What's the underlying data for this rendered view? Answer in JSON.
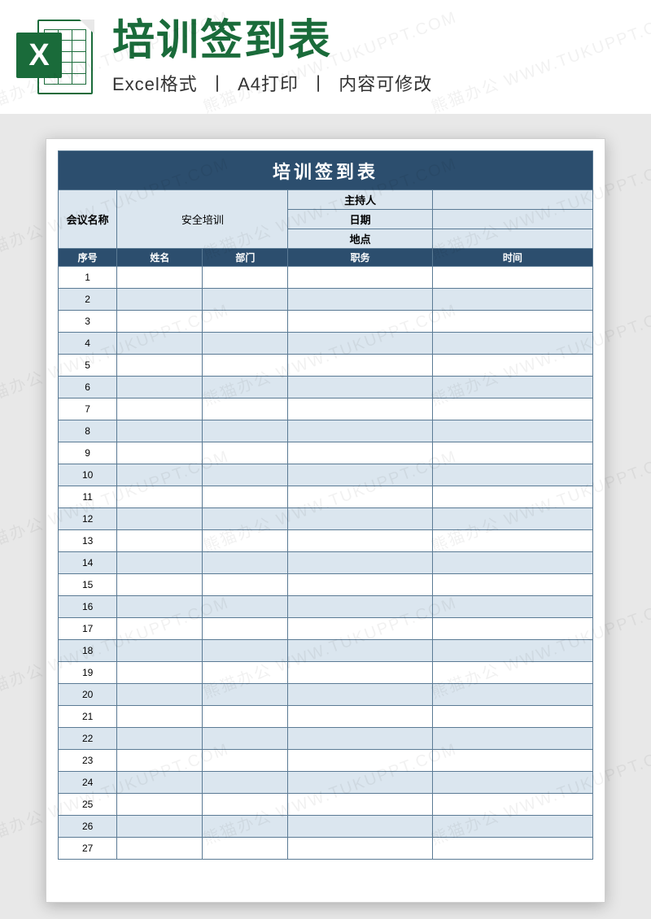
{
  "banner": {
    "title": "培训签到表",
    "sub_parts": [
      "Excel格式",
      "A4打印",
      "内容可修改"
    ],
    "excel_letter": "X"
  },
  "sheet": {
    "title": "培训签到表",
    "meta": {
      "meeting_label": "会议名称",
      "meeting_value": "安全培训",
      "host_label": "主持人",
      "host_value": "",
      "date_label": "日期",
      "date_value": "",
      "place_label": "地点",
      "place_value": ""
    },
    "columns": [
      "序号",
      "姓名",
      "部门",
      "职务",
      "时间"
    ],
    "rows": [
      {
        "num": "1",
        "name": "",
        "dept": "",
        "title": "",
        "time": ""
      },
      {
        "num": "2",
        "name": "",
        "dept": "",
        "title": "",
        "time": ""
      },
      {
        "num": "3",
        "name": "",
        "dept": "",
        "title": "",
        "time": ""
      },
      {
        "num": "4",
        "name": "",
        "dept": "",
        "title": "",
        "time": ""
      },
      {
        "num": "5",
        "name": "",
        "dept": "",
        "title": "",
        "time": ""
      },
      {
        "num": "6",
        "name": "",
        "dept": "",
        "title": "",
        "time": ""
      },
      {
        "num": "7",
        "name": "",
        "dept": "",
        "title": "",
        "time": ""
      },
      {
        "num": "8",
        "name": "",
        "dept": "",
        "title": "",
        "time": ""
      },
      {
        "num": "9",
        "name": "",
        "dept": "",
        "title": "",
        "time": ""
      },
      {
        "num": "10",
        "name": "",
        "dept": "",
        "title": "",
        "time": ""
      },
      {
        "num": "11",
        "name": "",
        "dept": "",
        "title": "",
        "time": ""
      },
      {
        "num": "12",
        "name": "",
        "dept": "",
        "title": "",
        "time": ""
      },
      {
        "num": "13",
        "name": "",
        "dept": "",
        "title": "",
        "time": ""
      },
      {
        "num": "14",
        "name": "",
        "dept": "",
        "title": "",
        "time": ""
      },
      {
        "num": "15",
        "name": "",
        "dept": "",
        "title": "",
        "time": ""
      },
      {
        "num": "16",
        "name": "",
        "dept": "",
        "title": "",
        "time": ""
      },
      {
        "num": "17",
        "name": "",
        "dept": "",
        "title": "",
        "time": ""
      },
      {
        "num": "18",
        "name": "",
        "dept": "",
        "title": "",
        "time": ""
      },
      {
        "num": "19",
        "name": "",
        "dept": "",
        "title": "",
        "time": ""
      },
      {
        "num": "20",
        "name": "",
        "dept": "",
        "title": "",
        "time": ""
      },
      {
        "num": "21",
        "name": "",
        "dept": "",
        "title": "",
        "time": ""
      },
      {
        "num": "22",
        "name": "",
        "dept": "",
        "title": "",
        "time": ""
      },
      {
        "num": "23",
        "name": "",
        "dept": "",
        "title": "",
        "time": ""
      },
      {
        "num": "24",
        "name": "",
        "dept": "",
        "title": "",
        "time": ""
      },
      {
        "num": "25",
        "name": "",
        "dept": "",
        "title": "",
        "time": ""
      },
      {
        "num": "26",
        "name": "",
        "dept": "",
        "title": "",
        "time": ""
      },
      {
        "num": "27",
        "name": "",
        "dept": "",
        "title": "",
        "time": ""
      }
    ]
  },
  "watermark_text": "熊猫办公 WWW.TUKUPPT.COM"
}
